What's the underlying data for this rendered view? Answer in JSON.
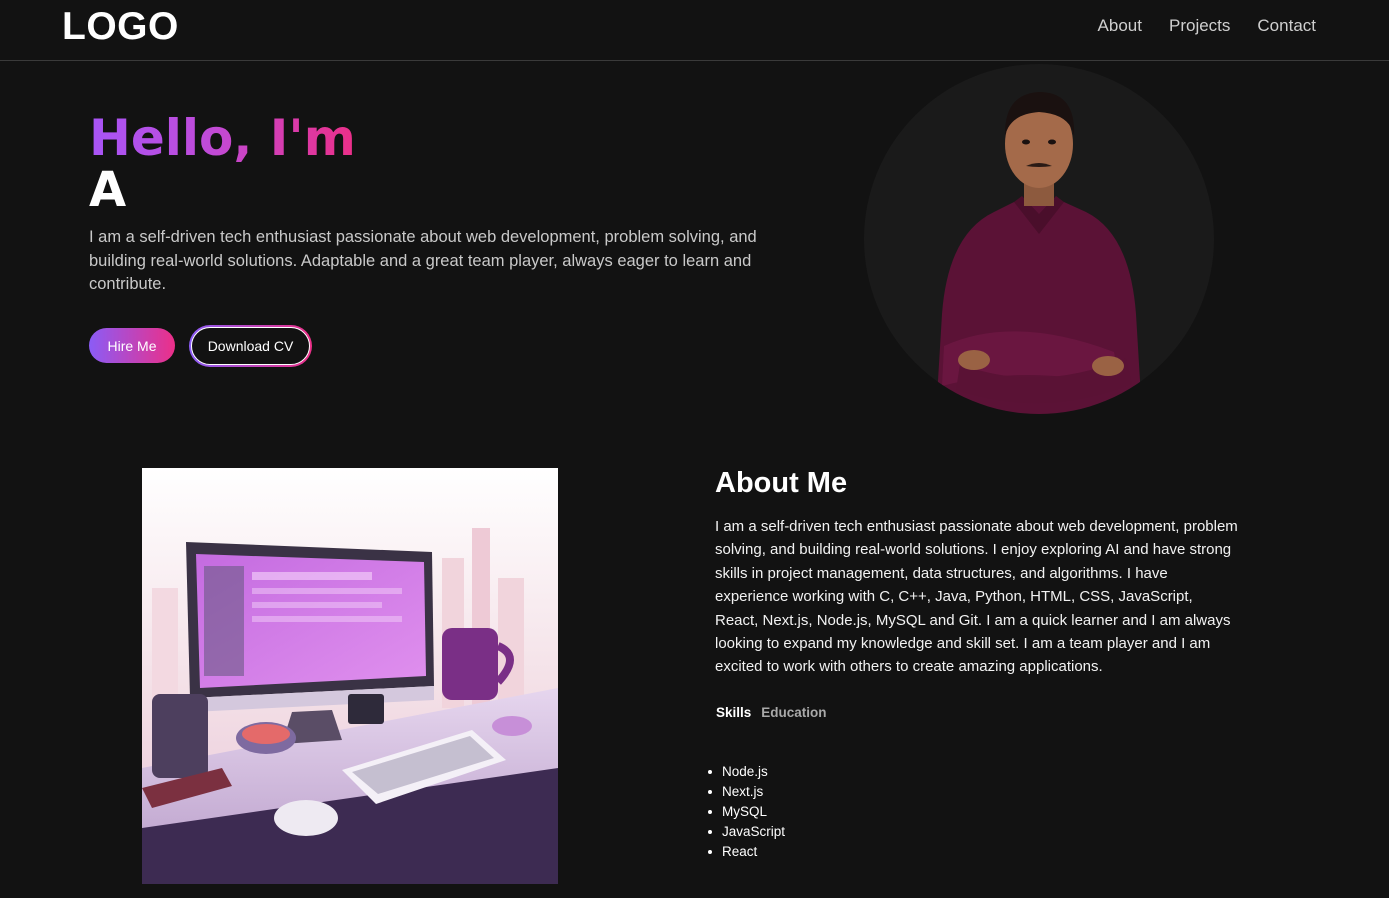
{
  "header": {
    "logo": "LOGO",
    "nav": [
      {
        "label": "About"
      },
      {
        "label": "Projects"
      },
      {
        "label": "Contact"
      }
    ]
  },
  "hero": {
    "greeting": "Hello, I'm",
    "name": "A",
    "description": "I am a self-driven tech enthusiast passionate about web development, problem solving, and building real-world solutions. Adaptable and a great team player, always eager to learn and contribute.",
    "hire_button": "Hire Me",
    "cv_button": "Download CV"
  },
  "about": {
    "title": "About Me",
    "text": "I am a self-driven tech enthusiast passionate about web development, problem solving, and building real-world solutions. I enjoy exploring AI and have strong skills in project management, data structures, and algorithms. I have experience working with C, C++, Java, Python, HTML, CSS, JavaScript, React, Next.js, Node.js, MySQL and Git. I am a quick learner and I am always looking to expand my knowledge and skill set. I am a team player and I am excited to work with others to create amazing applications.",
    "tabs": [
      {
        "label": "Skills",
        "active": true
      },
      {
        "label": "Education",
        "active": false
      }
    ],
    "skills": [
      "Node.js",
      "Next.js",
      "MySQL",
      "JavaScript",
      "React"
    ]
  },
  "colors": {
    "background": "#121212",
    "accent_purple": "#8b5cf6",
    "accent_pink": "#ec2f88"
  }
}
